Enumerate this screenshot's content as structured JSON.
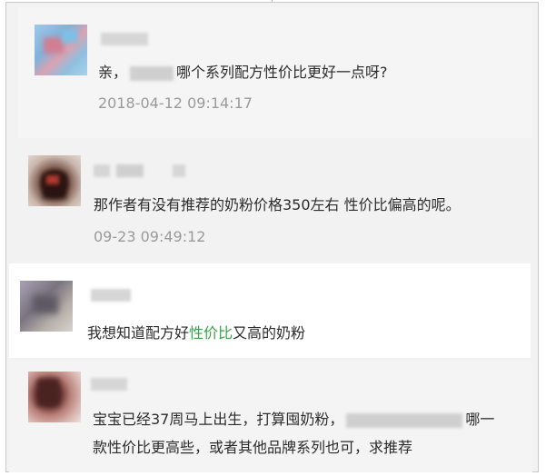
{
  "comments": [
    {
      "text_before": "亲，",
      "text_after": "哪个系列配方性价比更好一点呀?",
      "time": "2018-04-12 09:14:17",
      "avatar_icon": "user-avatar-icon"
    },
    {
      "text": "那作者有没有推荐的奶粉价格350左右 性价比偏高的呢。",
      "time": "09-23 09:49:12",
      "avatar_icon": "user-avatar-icon"
    },
    {
      "text_before": "我想知道配方好",
      "text_highlight": "性价比",
      "text_after": "又高的奶粉",
      "highlight_color": "#3aa14a",
      "avatar_icon": "user-avatar-icon"
    },
    {
      "line1_before": "宝宝已经37周马上出生，打算囤奶粉，",
      "line1_after": "哪一",
      "line2": "款性价比更高些，或者其他品牌系列也可，求推荐",
      "avatar_icon": "user-avatar-icon"
    }
  ]
}
